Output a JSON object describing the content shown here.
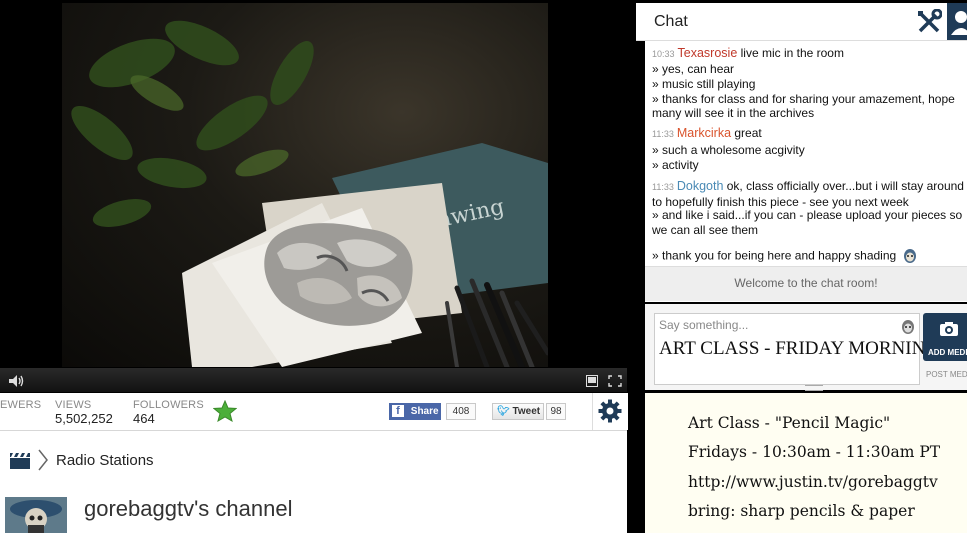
{
  "player": {
    "volume_icon": "speaker-icon",
    "icons": [
      "layout-icon",
      "fullscreen-icon"
    ]
  },
  "stats": {
    "viewers_label": "EWERS",
    "views_label": "VIEWS",
    "views_value": "5,502,252",
    "followers_label": "FOLLOWERS",
    "followers_value": "464",
    "share_label": "Share",
    "share_count": "408",
    "tweet_label": "Tweet",
    "tweet_count": "98",
    "settings_icon": "gear-icon",
    "star_icon": "star-icon"
  },
  "breadcrumb": {
    "icon": "clapperboard-icon",
    "label": "Radio Stations"
  },
  "channel": {
    "title": "gorebaggtv's channel"
  },
  "chat": {
    "title": "Chat",
    "messages": [
      {
        "time": "10:33",
        "user": "Texasrosie",
        "text": " live mic in the room",
        "color": "#c0392b"
      },
      {
        "text": "» yes, can hear"
      },
      {
        "text": "» music still playing"
      },
      {
        "text": "» thanks for class and for sharing your amazement, hope many will see it in the archives"
      },
      {
        "time": "11:33",
        "user": "Markcirka",
        "text": " great",
        "color": "#d9532c"
      },
      {
        "text": "» such a wholesome acgivity"
      },
      {
        "text": "» activity"
      },
      {
        "time": "11:33",
        "user": "Dokgoth",
        "text": " ok, class officially over...but i will stay around to hopefully finish this piece - see you next week",
        "color": "#4a8ab5"
      },
      {
        "text": "» and like i said...if you can - please upload your pieces so we can all see them"
      },
      {
        "text": "» thank you for being here and happy shading"
      }
    ],
    "welcome": "Welcome to the chat room!",
    "input_placeholder": "Say something...",
    "input_overlay": "ART CLASS - FRIDAY MORNINGS",
    "add_media_label": "ADD MEDI",
    "post_media_label": "POST MEDI"
  },
  "note": {
    "lines": [
      "Art Class - \"Pencil Magic\"",
      "Fridays - 10:30am - 11:30am PT",
      "http://www.justin.tv/gorebaggtv",
      "bring: sharp pencils  & paper"
    ]
  }
}
